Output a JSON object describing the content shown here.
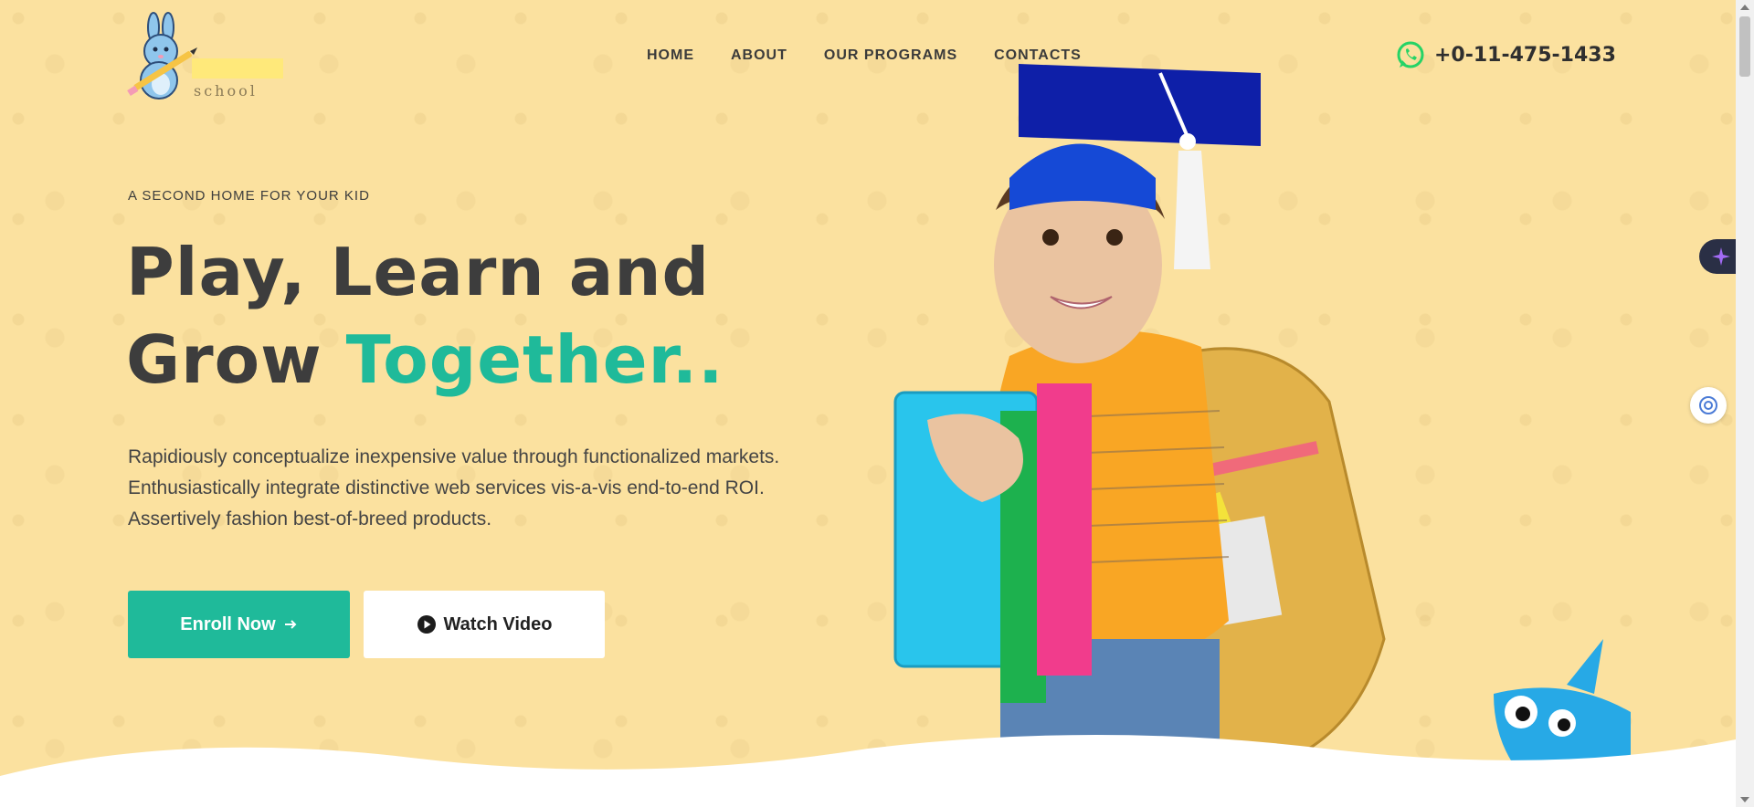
{
  "brand": {
    "subtitle": "school",
    "logo_icon": "bunny-with-pencil-icon"
  },
  "nav": {
    "items": [
      {
        "label": "HOME"
      },
      {
        "label": "ABOUT"
      },
      {
        "label": "OUR PROGRAMS"
      },
      {
        "label": "CONTACTS"
      }
    ]
  },
  "contact": {
    "phone": "+0-11-475-1433",
    "icon": "whatsapp-icon",
    "icon_color": "#25d366"
  },
  "hero": {
    "eyebrow": "A SECOND HOME FOR YOUR KID",
    "headline_line1": "Play, Learn and",
    "headline_line2_plain": "Grow",
    "headline_line2_accent": "Together..",
    "lead_line1": "Rapidiously conceptualize inexpensive value through functionalized markets.",
    "lead_line2": "Enthusiastically integrate distinctive web services vis-a-vis end-to-end ROI.",
    "lead_line3": "Assertively fashion best-of-breed products.",
    "enroll_label": "Enroll Now",
    "enroll_icon": "arrow-right-icon",
    "video_label": "Watch Video",
    "video_icon": "play-circle-icon"
  },
  "colors": {
    "background": "#fbe19f",
    "accent": "#1fba9a",
    "text": "#3d3d3d"
  }
}
